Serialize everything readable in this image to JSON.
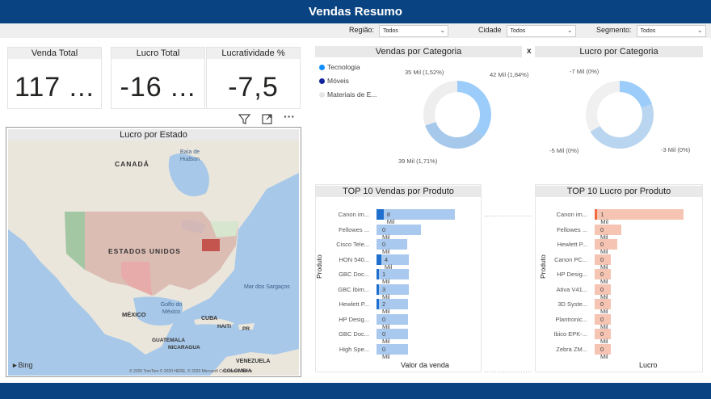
{
  "header": {
    "title": "Vendas Resumo"
  },
  "filters": [
    {
      "label": "Região:",
      "value": "Todos"
    },
    {
      "label": "Cidade",
      "value": "Todos"
    },
    {
      "label": "Segmento:",
      "value": "Todos"
    }
  ],
  "cards": [
    {
      "title": "Venda Total",
      "value": "117 ..."
    },
    {
      "title": "Lucro Total",
      "value": "-16 ..."
    },
    {
      "title": "Lucratividade %",
      "value": "-7,5"
    }
  ],
  "map": {
    "title": "Lucro por Estado",
    "labels": {
      "canada": "CANADÁ",
      "hudson": "Baía de Hudson",
      "usa": "ESTADOS UNIDOS",
      "sargaco": "Mar dos Sargaços",
      "golfo": "Golfo do México",
      "mexico": "MÉXICO",
      "cuba": "CUBA",
      "haiti": "HAITI",
      "pr": "PR",
      "guatemala": "GUATEMALA",
      "nicaragua": "NICARAGUA",
      "venezuela": "VENEZUELA",
      "colombia": "COLOMBIA"
    },
    "bing": "Bing",
    "copyright": "© 2020 TomTom © 2020 HERE, © 2020 Microsoft Corporation Terms"
  },
  "vendas_categoria": {
    "title": "Vendas por Categoria",
    "close": "x",
    "legend": [
      {
        "name": "Tecnologia",
        "color": "#118dff"
      },
      {
        "name": "Móveis",
        "color": "#12239e"
      },
      {
        "name": "Materiais de E...",
        "color": "#e6e6e6"
      }
    ],
    "labels": [
      "42 Mil (1,84%)",
      "39 Mil (1,71%)",
      "35 Mil (1,52%)"
    ]
  },
  "lucro_categoria": {
    "title": "Lucro por Categoria",
    "labels": [
      "-7 Mil (0%)",
      "-5 Mil (0%)",
      "-3 Mil (0%)"
    ]
  },
  "chart_data": [
    {
      "type": "pie",
      "title": "Vendas por Categoria",
      "categories": [
        "Tecnologia",
        "Móveis",
        "Materiais de E..."
      ],
      "values": [
        42,
        39,
        35
      ],
      "unit": "Mil"
    },
    {
      "type": "pie",
      "title": "Lucro por Categoria",
      "categories": [
        "Tecnologia",
        "Móveis",
        "Materiais de E..."
      ],
      "values": [
        -3,
        -7,
        -5
      ],
      "unit": "Mil"
    },
    {
      "type": "bar",
      "title": "TOP 10 Vendas por Produto",
      "xlabel": "Valor da venda",
      "ylabel": "Produto",
      "categories": [
        "Canon im...",
        "Fellowes ...",
        "Cisco Tele...",
        "HON 540...",
        "GBC Doc...",
        "GBC Ibim...",
        "Hewlett P...",
        "HP Desig...",
        "GBC Doc...",
        "High Spe..."
      ],
      "values": [
        8,
        0,
        0,
        4,
        1,
        3,
        2,
        0,
        0,
        0
      ],
      "value_labels": [
        "8 Mil",
        "0 Mil",
        "0 Mil",
        "4 Mil",
        "1 Mil",
        "3 Mil",
        "2 Mil",
        "0 Mil",
        "0 Mil",
        "0 Mil"
      ],
      "bar_fill": [
        1.0,
        0.57,
        0.39,
        0.41,
        0.41,
        0.41,
        0.4,
        0.4,
        0.4,
        0.4
      ],
      "highlight_fill": [
        0.09,
        0.0,
        0.0,
        0.06,
        0.02,
        0.03,
        0.02,
        0.0,
        0.0,
        0.0
      ]
    },
    {
      "type": "bar",
      "title": "TOP 10 Lucro por Produto",
      "xlabel": "Lucro",
      "ylabel": "Produto",
      "categories": [
        "Canon im...",
        "Fellowes ...",
        "Hewlett P...",
        "Canon PC...",
        "HP Desig...",
        "Ativa V41...",
        "3D Syste...",
        "Plantronic...",
        "Ibico EPK-...",
        "Zebra ZM..."
      ],
      "values": [
        1,
        0,
        0,
        0,
        0,
        0,
        0,
        0,
        0,
        0
      ],
      "value_labels": [
        "1 Mil",
        "0 Mil",
        "0 Mil",
        "0 Mil",
        "0 Mil",
        "0 Mil",
        "0 Mil",
        "0 Mil",
        "0 Mil",
        "0 Mil"
      ],
      "bar_fill": [
        1.0,
        0.3,
        0.25,
        0.18,
        0.18,
        0.18,
        0.18,
        0.18,
        0.18,
        0.18
      ],
      "highlight_fill": [
        0.03,
        0.0,
        0.0,
        0.0,
        0.0,
        0.0,
        0.0,
        0.0,
        0.0,
        0.0
      ]
    }
  ]
}
